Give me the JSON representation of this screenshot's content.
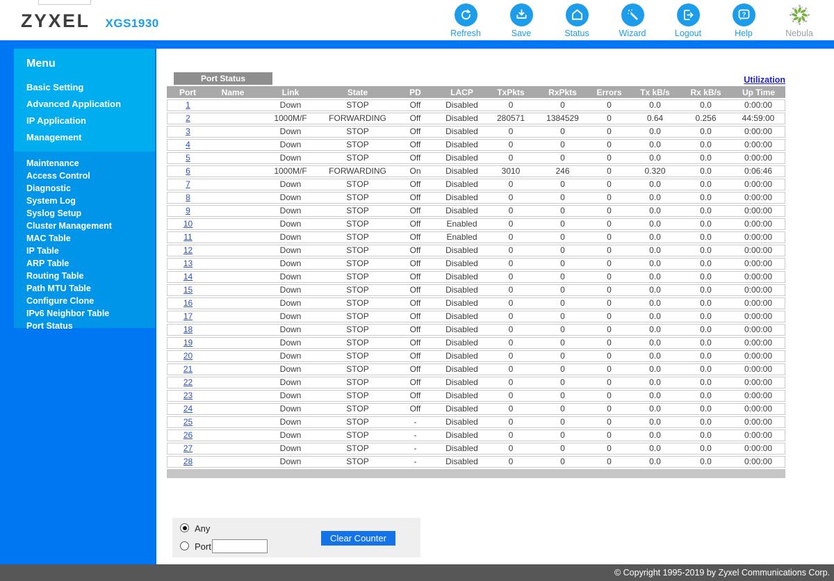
{
  "header": {
    "brand": "ZYXEL",
    "model": "XGS1930",
    "toolbar": [
      {
        "label": "Refresh",
        "icon": "refresh-icon"
      },
      {
        "label": "Save",
        "icon": "save-icon"
      },
      {
        "label": "Status",
        "icon": "status-icon"
      },
      {
        "label": "Wizard",
        "icon": "wizard-icon"
      },
      {
        "label": "Logout",
        "icon": "logout-icon"
      },
      {
        "label": "Help",
        "icon": "help-icon"
      },
      {
        "label": "Nebula",
        "icon": "nebula-icon"
      }
    ]
  },
  "sidebar": {
    "title": "Menu",
    "main_items": [
      "Basic Setting",
      "Advanced Application",
      "IP Application",
      "Management"
    ],
    "sub_items": [
      "Maintenance",
      "Access Control",
      "Diagnostic",
      "System Log",
      "Syslog Setup",
      "Cluster Management",
      "MAC Table",
      "IP Table",
      "ARP Table",
      "Routing Table",
      "Path MTU Table",
      "Configure Clone",
      "IPv6 Neighbor Table",
      "Port Status"
    ]
  },
  "main": {
    "tab_label": "Port Status",
    "utilization_link": "Utilization",
    "table": {
      "columns": [
        "Port",
        "Name",
        "Link",
        "State",
        "PD",
        "LACP",
        "TxPkts",
        "RxPkts",
        "Errors",
        "Tx kB/s",
        "Rx kB/s",
        "Up Time"
      ],
      "rows": [
        [
          "1",
          "",
          "Down",
          "STOP",
          "Off",
          "Disabled",
          "0",
          "0",
          "0",
          "0.0",
          "0.0",
          "0:00:00"
        ],
        [
          "2",
          "",
          "1000M/F",
          "FORWARDING",
          "Off",
          "Disabled",
          "280571",
          "1384529",
          "0",
          "0.64",
          "0.256",
          "44:59:00"
        ],
        [
          "3",
          "",
          "Down",
          "STOP",
          "Off",
          "Disabled",
          "0",
          "0",
          "0",
          "0.0",
          "0.0",
          "0:00:00"
        ],
        [
          "4",
          "",
          "Down",
          "STOP",
          "Off",
          "Disabled",
          "0",
          "0",
          "0",
          "0.0",
          "0.0",
          "0:00:00"
        ],
        [
          "5",
          "",
          "Down",
          "STOP",
          "Off",
          "Disabled",
          "0",
          "0",
          "0",
          "0.0",
          "0.0",
          "0:00:00"
        ],
        [
          "6",
          "",
          "1000M/F",
          "FORWARDING",
          "On",
          "Disabled",
          "3010",
          "246",
          "0",
          "0.320",
          "0.0",
          "0:06:46"
        ],
        [
          "7",
          "",
          "Down",
          "STOP",
          "Off",
          "Disabled",
          "0",
          "0",
          "0",
          "0.0",
          "0.0",
          "0:00:00"
        ],
        [
          "8",
          "",
          "Down",
          "STOP",
          "Off",
          "Disabled",
          "0",
          "0",
          "0",
          "0.0",
          "0.0",
          "0:00:00"
        ],
        [
          "9",
          "",
          "Down",
          "STOP",
          "Off",
          "Disabled",
          "0",
          "0",
          "0",
          "0.0",
          "0.0",
          "0:00:00"
        ],
        [
          "10",
          "",
          "Down",
          "STOP",
          "Off",
          "Enabled",
          "0",
          "0",
          "0",
          "0.0",
          "0.0",
          "0:00:00"
        ],
        [
          "11",
          "",
          "Down",
          "STOP",
          "Off",
          "Enabled",
          "0",
          "0",
          "0",
          "0.0",
          "0.0",
          "0:00:00"
        ],
        [
          "12",
          "",
          "Down",
          "STOP",
          "Off",
          "Disabled",
          "0",
          "0",
          "0",
          "0.0",
          "0.0",
          "0:00:00"
        ],
        [
          "13",
          "",
          "Down",
          "STOP",
          "Off",
          "Disabled",
          "0",
          "0",
          "0",
          "0.0",
          "0.0",
          "0:00:00"
        ],
        [
          "14",
          "",
          "Down",
          "STOP",
          "Off",
          "Disabled",
          "0",
          "0",
          "0",
          "0.0",
          "0.0",
          "0:00:00"
        ],
        [
          "15",
          "",
          "Down",
          "STOP",
          "Off",
          "Disabled",
          "0",
          "0",
          "0",
          "0.0",
          "0.0",
          "0:00:00"
        ],
        [
          "16",
          "",
          "Down",
          "STOP",
          "Off",
          "Disabled",
          "0",
          "0",
          "0",
          "0.0",
          "0.0",
          "0:00:00"
        ],
        [
          "17",
          "",
          "Down",
          "STOP",
          "Off",
          "Disabled",
          "0",
          "0",
          "0",
          "0.0",
          "0.0",
          "0:00:00"
        ],
        [
          "18",
          "",
          "Down",
          "STOP",
          "Off",
          "Disabled",
          "0",
          "0",
          "0",
          "0.0",
          "0.0",
          "0:00:00"
        ],
        [
          "19",
          "",
          "Down",
          "STOP",
          "Off",
          "Disabled",
          "0",
          "0",
          "0",
          "0.0",
          "0.0",
          "0:00:00"
        ],
        [
          "20",
          "",
          "Down",
          "STOP",
          "Off",
          "Disabled",
          "0",
          "0",
          "0",
          "0.0",
          "0.0",
          "0:00:00"
        ],
        [
          "21",
          "",
          "Down",
          "STOP",
          "Off",
          "Disabled",
          "0",
          "0",
          "0",
          "0.0",
          "0.0",
          "0:00:00"
        ],
        [
          "22",
          "",
          "Down",
          "STOP",
          "Off",
          "Disabled",
          "0",
          "0",
          "0",
          "0.0",
          "0.0",
          "0:00:00"
        ],
        [
          "23",
          "",
          "Down",
          "STOP",
          "Off",
          "Disabled",
          "0",
          "0",
          "0",
          "0.0",
          "0.0",
          "0:00:00"
        ],
        [
          "24",
          "",
          "Down",
          "STOP",
          "Off",
          "Disabled",
          "0",
          "0",
          "0",
          "0.0",
          "0.0",
          "0:00:00"
        ],
        [
          "25",
          "",
          "Down",
          "STOP",
          "-",
          "Disabled",
          "0",
          "0",
          "0",
          "0.0",
          "0.0",
          "0:00:00"
        ],
        [
          "26",
          "",
          "Down",
          "STOP",
          "-",
          "Disabled",
          "0",
          "0",
          "0",
          "0.0",
          "0.0",
          "0:00:00"
        ],
        [
          "27",
          "",
          "Down",
          "STOP",
          "-",
          "Disabled",
          "0",
          "0",
          "0",
          "0.0",
          "0.0",
          "0:00:00"
        ],
        [
          "28",
          "",
          "Down",
          "STOP",
          "-",
          "Disabled",
          "0",
          "0",
          "0",
          "0.0",
          "0.0",
          "0:00:00"
        ]
      ]
    },
    "controls": {
      "radio_any_label": "Any",
      "radio_port_label": "Port",
      "selected": "any",
      "port_input_value": "",
      "clear_button_label": "Clear Counter"
    }
  },
  "footer": {
    "copyright": "© Copyright 1995-2019 by Zyxel Communications Corp."
  },
  "colors": {
    "sidebar_blue": "#0077f2",
    "panel_top_blue": "#00aef0",
    "panel_sub_blue": "#0095e8",
    "icon_blue": "#1b9deb",
    "tab_gray": "#8e8e8e",
    "table_header_gray": "#a9a9a9",
    "button_blue": "#1473e6",
    "footer_gray": "#575757",
    "port_link_blue": "#2c50c8",
    "utilization_link_blue": "#2222cf",
    "nebula_green": "#76b041"
  }
}
